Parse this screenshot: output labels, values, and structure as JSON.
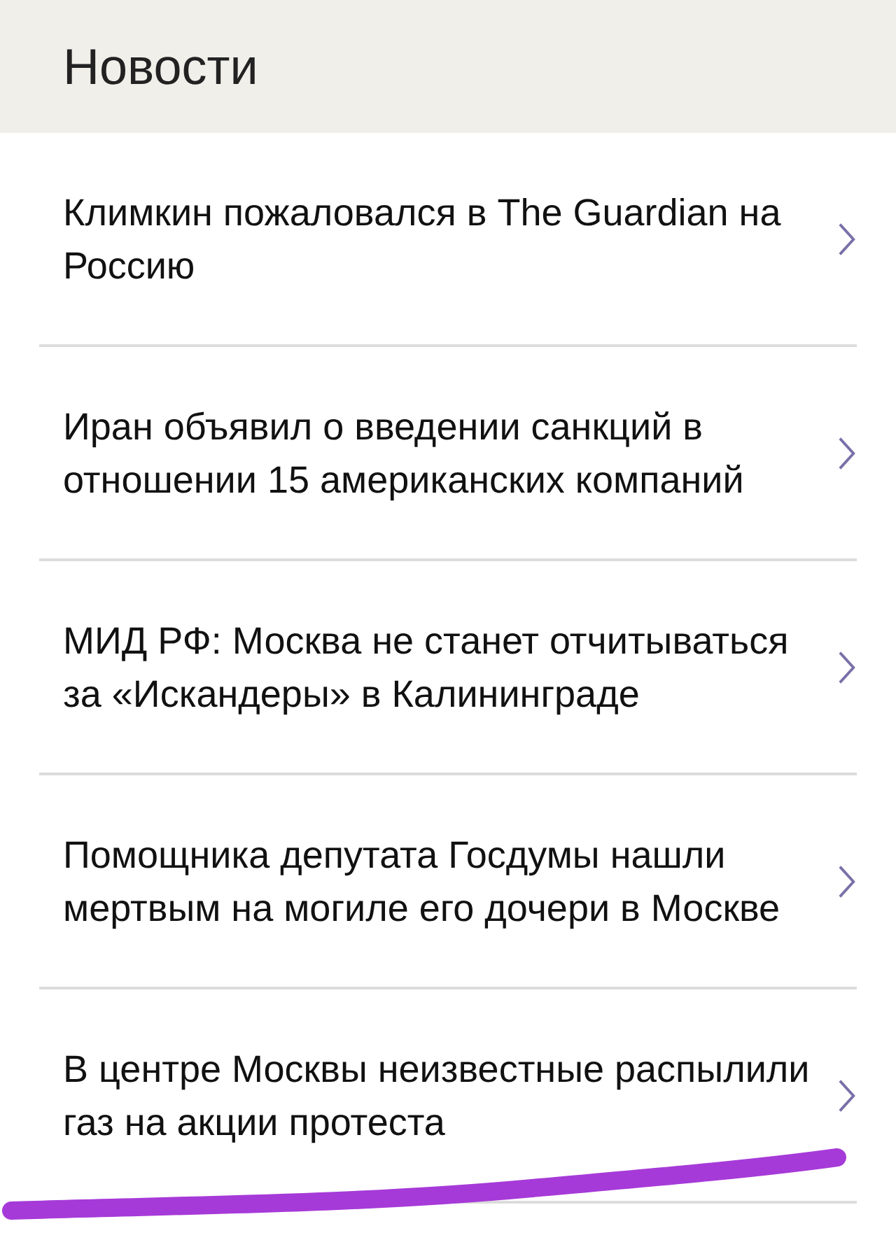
{
  "header": {
    "title": "Новости"
  },
  "news": [
    {
      "title": "Климкин пожаловался в The Guardian на Россию"
    },
    {
      "title": "Иран объявил о введении санкций в отношении 15 американских компаний"
    },
    {
      "title": "МИД РФ: Москва не станет отчитываться за «Искандеры» в Калининграде"
    },
    {
      "title": "Помощника депутата Госдумы нашли мертвым на могиле его дочери в Москве"
    },
    {
      "title": "В центре Москвы неизвестные распылили газ на акции протеста"
    }
  ]
}
